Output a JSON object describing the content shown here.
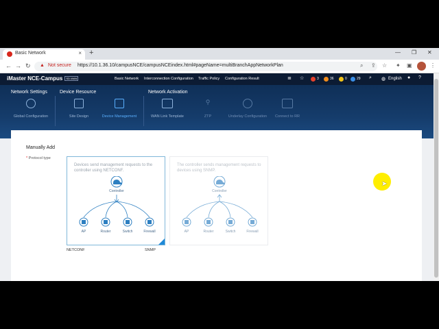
{
  "browser": {
    "tab_title": "Basic Network",
    "new_tab": "+",
    "close": "×",
    "not_secure": "Not secure",
    "url": "https://10.1.36.10/campusNCE/campusNCEindex.html#pageName=multiBranchAppNetworkPlan"
  },
  "app": {
    "logo": "iMaster NCE-Campus",
    "logo_tag": "SD-WAN",
    "menu": [
      "Basic Network",
      "Interconnection Configuration",
      "Traffic Policy",
      "Configuration Result"
    ],
    "badges": [
      {
        "count": "3",
        "color": "#e5412d"
      },
      {
        "count": "36",
        "color": "#f08b1c"
      },
      {
        "count": "0",
        "color": "#f2c318"
      },
      {
        "count": "29",
        "color": "#3a8ee6"
      }
    ],
    "language": "English"
  },
  "wizard": {
    "sections": [
      "Network Settings",
      "Device Resource",
      "Network Activation"
    ],
    "steps": [
      {
        "label": "Global Configuration",
        "state": "done"
      },
      {
        "label": "Site Design",
        "state": "done"
      },
      {
        "label": "Device Management",
        "state": "active"
      },
      {
        "label": "WAN Link Template",
        "state": "done"
      },
      {
        "label": "ZTP",
        "state": "pending"
      },
      {
        "label": "Underlay Configuration",
        "state": "pending"
      },
      {
        "label": "Connect to RR",
        "state": "pending"
      }
    ]
  },
  "content": {
    "title": "Manually Add",
    "protocol_label": "Protocol type",
    "required_mark": "*",
    "cards": [
      {
        "description": "Devices send management requests to the controller using NETCONF.",
        "controller": "Controller",
        "devices": [
          "AP",
          "Router",
          "Switch",
          "Firewall"
        ],
        "left_caption": "NETCONF",
        "right_caption": "SNMP",
        "selected": true
      },
      {
        "description": "The controller sends management requests to devices using SNMP.",
        "controller": "Controller",
        "devices": [
          "AP",
          "Router",
          "Switch",
          "Firewall"
        ],
        "selected": false
      }
    ]
  },
  "colors": {
    "accent": "#1f8ad8",
    "header": "#0c1b33",
    "band": "#153c6b",
    "icon": "#2d7fc1"
  }
}
